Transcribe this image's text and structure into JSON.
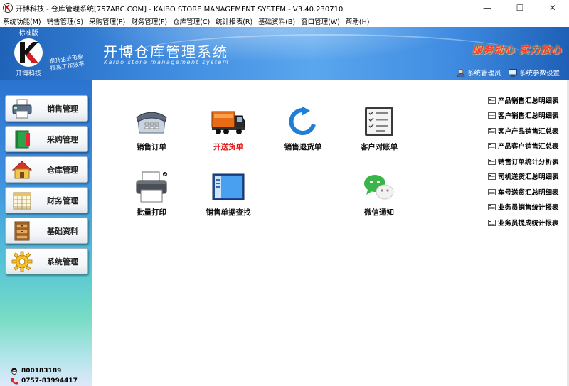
{
  "window": {
    "title": "开博科技 - 仓库管理系统[757ABC.COM] - KAIBO STORE MANAGEMENT SYSTEM - V3.40.230710",
    "minimize": "—",
    "maximize": "☐",
    "close": "✕"
  },
  "menu": [
    "系统功能(M)",
    "销售管理(S)",
    "采购管理(P)",
    "财务管理(F)",
    "仓库管理(C)",
    "统计报表(R)",
    "基础资料(B)",
    "窗口管理(W)",
    "帮助(H)"
  ],
  "header": {
    "edition": "标准版",
    "company": "开博科技",
    "slogan_line1": "提升企业形象",
    "slogan_line2": "提高工作效率",
    "system_title": "开博仓库管理系统",
    "system_subtitle": "Kaibo store management system",
    "motto": "服务动心 实力放心",
    "user_label": "系统管理员",
    "settings_label": "系统参数设置",
    "brand_color": "#2e78d4",
    "motto_color": "#ff3a2a"
  },
  "sidebar": {
    "items": [
      {
        "label": "销售管理",
        "icon": "printer-icon"
      },
      {
        "label": "采购管理",
        "icon": "book-icon"
      },
      {
        "label": "仓库管理",
        "icon": "house-icon"
      },
      {
        "label": "财务管理",
        "icon": "calendar-icon"
      },
      {
        "label": "基础资料",
        "icon": "cabinet-icon"
      },
      {
        "label": "系统管理",
        "icon": "gear-icon"
      }
    ],
    "qq": "800183189",
    "phone": "0757-83994417"
  },
  "tiles": [
    {
      "label": "销售订单",
      "icon": "telephone-icon",
      "highlight": false
    },
    {
      "label": "开送货单",
      "icon": "truck-icon",
      "highlight": true
    },
    {
      "label": "销售退货单",
      "icon": "refresh-icon",
      "highlight": false
    },
    {
      "label": "客户对账单",
      "icon": "checklist-icon",
      "highlight": false
    },
    {
      "label": "批量打印",
      "icon": "printer-icon",
      "highlight": false
    },
    {
      "label": "销售单据查找",
      "icon": "window-icon",
      "highlight": false
    },
    {
      "label": "微信通知",
      "icon": "wechat-icon",
      "highlight": false
    }
  ],
  "reports": [
    "产品销售汇总明细表",
    "客户销售汇总明细表",
    "客户产品销售汇总表",
    "产品客户销售汇总表",
    "销售订单统计分析表",
    "司机送货汇总明细表",
    "车号送货汇总明细表",
    "业务员销售统计报表",
    "业务员提成统计报表"
  ]
}
